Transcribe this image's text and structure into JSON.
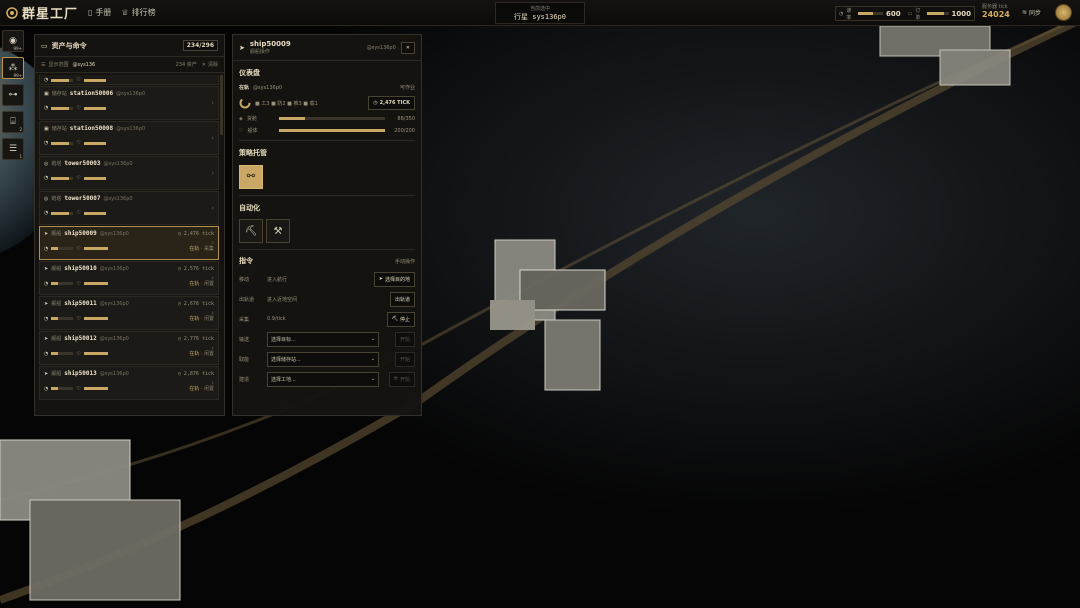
{
  "app": {
    "title": "群星工厂",
    "nav": [
      {
        "icon": "book-icon",
        "label": "手册"
      },
      {
        "icon": "trophy-icon",
        "label": "排行榜"
      }
    ]
  },
  "location": {
    "sub": "当前选中",
    "value": "行星 sys136p0"
  },
  "resources": [
    {
      "label": "速率",
      "value": "600",
      "fill": 0.6
    },
    {
      "label": "订单",
      "value": "1000",
      "fill": 0.8
    }
  ],
  "server": {
    "label": "服务器 tick",
    "value": "24024"
  },
  "sync": "同步",
  "sidebar": [
    {
      "icon": "radar-icon",
      "badge": "99+"
    },
    {
      "icon": "cluster-icon",
      "badge": "99+"
    },
    {
      "icon": "route-icon",
      "badge": ""
    },
    {
      "icon": "terminal-icon",
      "badge": "2"
    },
    {
      "icon": "task-icon",
      "badge": "1"
    }
  ],
  "assets": {
    "title": "资产与命令",
    "count": "234/296",
    "filter": "显示范围",
    "filter_val": "@sys136",
    "filter_count": "234 资产",
    "clear": "清除",
    "items": [
      {
        "cat": "",
        "name": "",
        "owner": "",
        "tick": "",
        "status": "",
        "selected": false,
        "partial": true
      },
      {
        "cat": "储存站",
        "name": "station50006",
        "owner": "@sys136p0",
        "tick": "",
        "status": "",
        "selected": false
      },
      {
        "cat": "储存站",
        "name": "station50008",
        "owner": "@sys136p0",
        "tick": "",
        "status": "",
        "selected": false
      },
      {
        "cat": "炮塔",
        "name": "tower50003",
        "owner": "@sys136p0",
        "tick": "",
        "status": "",
        "selected": false
      },
      {
        "cat": "炮塔",
        "name": "tower50007",
        "owner": "@sys136p0",
        "tick": "",
        "status": "",
        "selected": false
      },
      {
        "cat": "舰船",
        "name": "ship50009",
        "owner": "@sys136p0",
        "tick": "2,476 tick",
        "status": "在轨",
        "act": "采集",
        "selected": true
      },
      {
        "cat": "舰船",
        "name": "ship50010",
        "owner": "@sys136p0",
        "tick": "2,576 tick",
        "status": "在轨",
        "act": "闲置",
        "selected": false
      },
      {
        "cat": "舰船",
        "name": "ship50011",
        "owner": "@sys136p0",
        "tick": "2,676 tick",
        "status": "在轨",
        "act": "闲置",
        "selected": false
      },
      {
        "cat": "舰船",
        "name": "ship50012",
        "owner": "@sys136p0",
        "tick": "2,776 tick",
        "status": "在轨",
        "act": "闲置",
        "selected": false
      },
      {
        "cat": "舰船",
        "name": "ship50013",
        "owner": "@sys136p0",
        "tick": "2,876 tick",
        "status": "在轨",
        "act": "闲置",
        "selected": false
      }
    ]
  },
  "detail": {
    "name": "ship50009",
    "type": "舰船操作",
    "owner": "@sys136p0",
    "dash": {
      "title": "仪表盘",
      "state": "在轨",
      "loc": "@sys136p0",
      "avail": "可作业",
      "legend": "■ 工3 ■ 防2 ■ 推3 ■ 载1",
      "tick": "2,476 TICK",
      "cargo": {
        "label": "货舱",
        "value": "86/350",
        "fill": 0.25
      },
      "hull": {
        "label": "船体",
        "value": "200/200",
        "fill": 1.0
      }
    },
    "policy": {
      "title": "策略托管"
    },
    "auto": {
      "title": "自动化"
    },
    "cmd": {
      "title": "指令",
      "mode": "手动操作",
      "rows": [
        {
          "k": "移动",
          "v": "进入航行",
          "btn": "选择目的地"
        },
        {
          "k": "出轨道",
          "v": "进入近地空间",
          "btn": "出轨道"
        },
        {
          "k": "采集",
          "v": "0.9/tick",
          "btn": "停止"
        }
      ],
      "selects": [
        {
          "k": "输送",
          "ph": "选择目标...",
          "btn": "开始"
        },
        {
          "k": "取能",
          "ph": "选择储存站...",
          "btn": "开始"
        },
        {
          "k": "建造",
          "ph": "选择工地...",
          "btn": "开始"
        }
      ]
    }
  }
}
